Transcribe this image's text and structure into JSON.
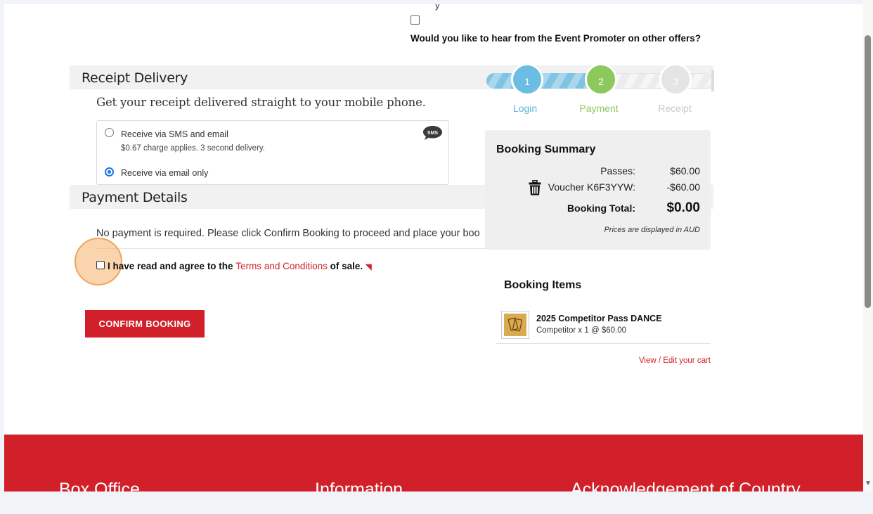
{
  "promoter": {
    "top_cut_text": "y",
    "question": "Would you like to hear from the Event Promoter on other offers?"
  },
  "receipt": {
    "title": "Receipt Delivery",
    "intro": "Get your receipt delivered straight to your mobile phone.",
    "options": [
      {
        "label": "Receive via SMS and email",
        "sub": "$0.67 charge applies. 3 second delivery.",
        "selected": false
      },
      {
        "label": "Receive via email only",
        "sub": "",
        "selected": true
      }
    ],
    "sms_badge": "SMS"
  },
  "payment": {
    "title": "Payment Details",
    "note": "No payment is required. Please click Confirm Booking to proceed and place your boo",
    "terms_prefix": "I have read and agree to the ",
    "terms_link": "Terms and Conditions",
    "terms_suffix": " of sale.",
    "confirm_label": "CONFIRM BOOKING"
  },
  "steps": [
    {
      "number": "1",
      "label": "Login",
      "state": "done",
      "color": "#6cbde3"
    },
    {
      "number": "2",
      "label": "Payment",
      "state": "current",
      "color": "#8cc95c"
    },
    {
      "number": "3",
      "label": "Receipt",
      "state": "todo",
      "color": "#e4e4e4"
    }
  ],
  "summary": {
    "title": "Booking Summary",
    "passes_label": "Passes:",
    "passes_value": "$60.00",
    "voucher_label": "Voucher K6F3YYW:",
    "voucher_value": "-$60.00",
    "total_label": "Booking Total:",
    "total_value": "$0.00",
    "currency_note": "Prices are displayed in AUD"
  },
  "items": {
    "title": "Booking Items",
    "list": [
      {
        "name": "2025 Competitor Pass DANCE",
        "detail": "Competitor x 1 @ $60.00"
      }
    ],
    "edit_link": "View / Edit your cart"
  },
  "footer": {
    "col1": "Box Office",
    "col2": "Information",
    "col3": "Acknowledgement of Country"
  },
  "colors": {
    "brand_red": "#d1202a",
    "step_blue": "#6cbde3",
    "step_green": "#8cc95c",
    "radio_blue": "#1a73e8"
  }
}
